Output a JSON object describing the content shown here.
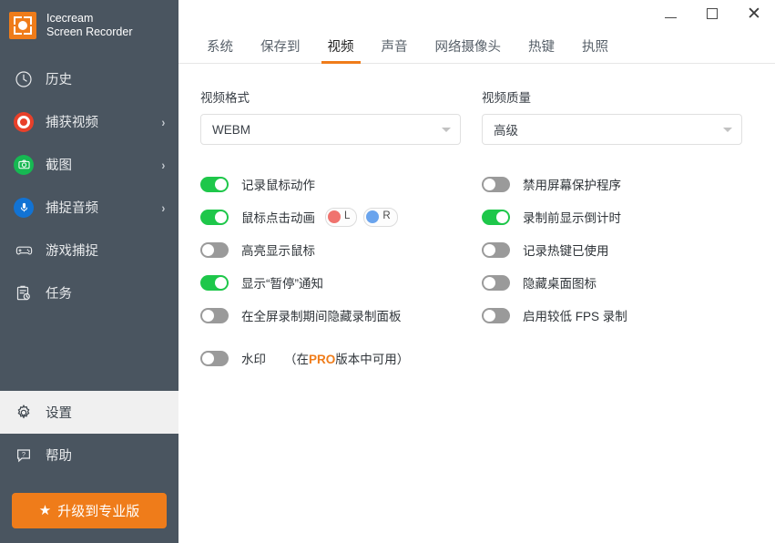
{
  "brand": {
    "logo_icon": "record-frame-icon",
    "line1": "Icecream",
    "line2": "Screen Recorder"
  },
  "sidebar": {
    "items": [
      {
        "label": "历史",
        "icon": "clock-icon",
        "chevron": "",
        "active": false
      },
      {
        "label": "捕获视频",
        "icon": "record-icon",
        "chevron": "›",
        "active": false
      },
      {
        "label": "截图",
        "icon": "camera-icon",
        "chevron": "›",
        "active": false
      },
      {
        "label": "捕捉音频",
        "icon": "microphone-icon",
        "chevron": "›",
        "active": false
      },
      {
        "label": "游戏捕捉",
        "icon": "gamepad-icon",
        "chevron": "",
        "active": false
      },
      {
        "label": "任务",
        "icon": "tasks-icon",
        "chevron": "",
        "active": false
      }
    ],
    "bottom_items": [
      {
        "label": "设置",
        "icon": "gear-icon",
        "active": true
      },
      {
        "label": "帮助",
        "icon": "help-icon",
        "active": false
      }
    ],
    "upgrade": {
      "label": "升级到专业版",
      "icon": "star-icon"
    }
  },
  "titlebar": {
    "minimize": "minimize-icon",
    "maximize": "maximize-icon",
    "close": "✕"
  },
  "tabs": [
    {
      "label": "系统",
      "selected": false
    },
    {
      "label": "保存到",
      "selected": false
    },
    {
      "label": "视频",
      "selected": true
    },
    {
      "label": "声音",
      "selected": false
    },
    {
      "label": "网络摄像头",
      "selected": false
    },
    {
      "label": "热键",
      "selected": false
    },
    {
      "label": "执照",
      "selected": false
    }
  ],
  "settings": {
    "video_format": {
      "label": "视频格式",
      "value": "WEBM"
    },
    "video_quality": {
      "label": "视频质量",
      "value": "高级"
    },
    "left_toggles": [
      {
        "label": "记录鼠标动作",
        "on": true
      },
      {
        "label": "鼠标点击动画",
        "on": true
      },
      {
        "label": "高亮显示鼠标",
        "on": false
      },
      {
        "label": "显示“暂停”通知",
        "on": true
      },
      {
        "label": "在全屏录制期间隐藏录制面板",
        "on": false
      }
    ],
    "click_chips": [
      {
        "text": "L",
        "color": "#f0736e"
      },
      {
        "text": "R",
        "color": "#6aa4ed"
      }
    ],
    "right_toggles": [
      {
        "label": "禁用屏幕保护程序",
        "on": false
      },
      {
        "label": "录制前显示倒计时",
        "on": true
      },
      {
        "label": "记录热键已使用",
        "on": false
      },
      {
        "label": "隐藏桌面图标",
        "on": false
      },
      {
        "label": "启用较低 FPS 录制",
        "on": false
      }
    ],
    "watermark": {
      "label": "水印",
      "on": false,
      "note_prefix": "（在",
      "note_pro": "PRO",
      "note_suffix": "版本中可用）"
    }
  },
  "colors": {
    "sidebar_bg": "#4a5560",
    "accent_orange": "#ef7c1a",
    "toggle_on": "#1ec74a",
    "toggle_off": "#9a9a9a"
  }
}
